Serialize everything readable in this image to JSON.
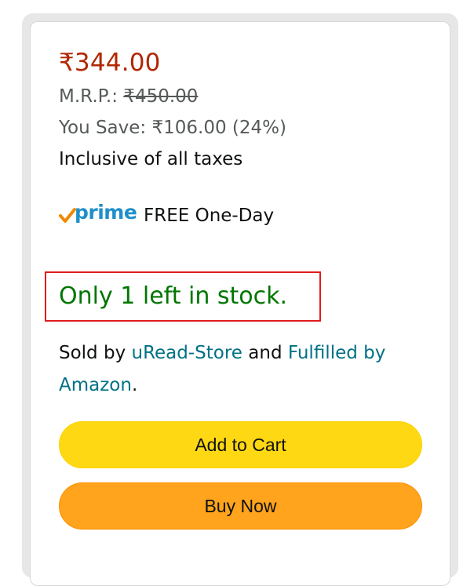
{
  "price": {
    "current": "₹344.00",
    "mrp_label": "M.R.P.:",
    "mrp_value": "₹450.00",
    "you_save": "You Save: ₹106.00 (24%)",
    "tax_note": "Inclusive of all taxes"
  },
  "delivery": {
    "prime_word": "prime",
    "text": "FREE One-Day"
  },
  "stock": {
    "text": "Only 1 left in stock."
  },
  "seller": {
    "sold_by": "Sold by",
    "seller_name": "uRead-Store",
    "and": "and",
    "fulfilled": "Fulfilled by Amazon",
    "period": "."
  },
  "buttons": {
    "add_to_cart": "Add to Cart",
    "buy_now": "Buy Now"
  },
  "colors": {
    "price": "#b12704",
    "stock": "#007600",
    "link": "#007185",
    "cart_button": "#ffd814",
    "buy_button": "#ffa41c",
    "highlight_box": "#e11c1c"
  },
  "icons": {
    "prime": "prime-check-icon"
  }
}
